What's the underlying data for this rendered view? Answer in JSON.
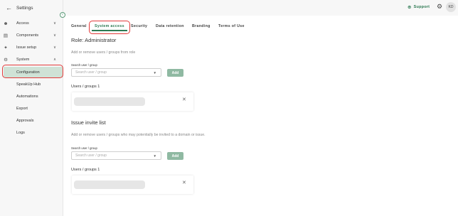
{
  "header": {
    "back_icon": "arrow-left-icon",
    "title": "Settings"
  },
  "sidebar": {
    "items": [
      {
        "label": "Access",
        "icon": "users-icon"
      },
      {
        "label": "Components",
        "icon": "database-icon"
      },
      {
        "label": "Issue setup",
        "icon": "wrench-icon"
      },
      {
        "label": "System",
        "icon": "gear-icon"
      }
    ],
    "sub_items": [
      {
        "label": "Configuration"
      },
      {
        "label": "SpeakUp Hub"
      },
      {
        "label": "Automations"
      },
      {
        "label": "Export"
      },
      {
        "label": "Approvals"
      },
      {
        "label": "Logs"
      }
    ]
  },
  "topbar": {
    "support_label": "Support",
    "avatar_initials": "KD"
  },
  "tabs": [
    "General",
    "System access",
    "Security",
    "Data retention",
    "Branding",
    "Terms of Use"
  ],
  "role_section": {
    "heading": "Role: Administrator",
    "description": "Add or remove users / groups from role",
    "field_label": "Search user / group",
    "placeholder": "Search user / group",
    "add_label": "Add",
    "count_label": "Users / groups 1"
  },
  "invite_section": {
    "heading": "Issue invite list",
    "description": "Add or remove users / groups who may potentially be invited to a domain or issue.",
    "field_label": "Search user / group",
    "placeholder": "Search user / group",
    "add_label": "Add",
    "count_label": "Users / groups 1"
  },
  "colors": {
    "accent": "#2e7a53",
    "active_bg": "#cfe2d6",
    "highlight": "#e23a3a",
    "button": "#8fb9a2"
  }
}
